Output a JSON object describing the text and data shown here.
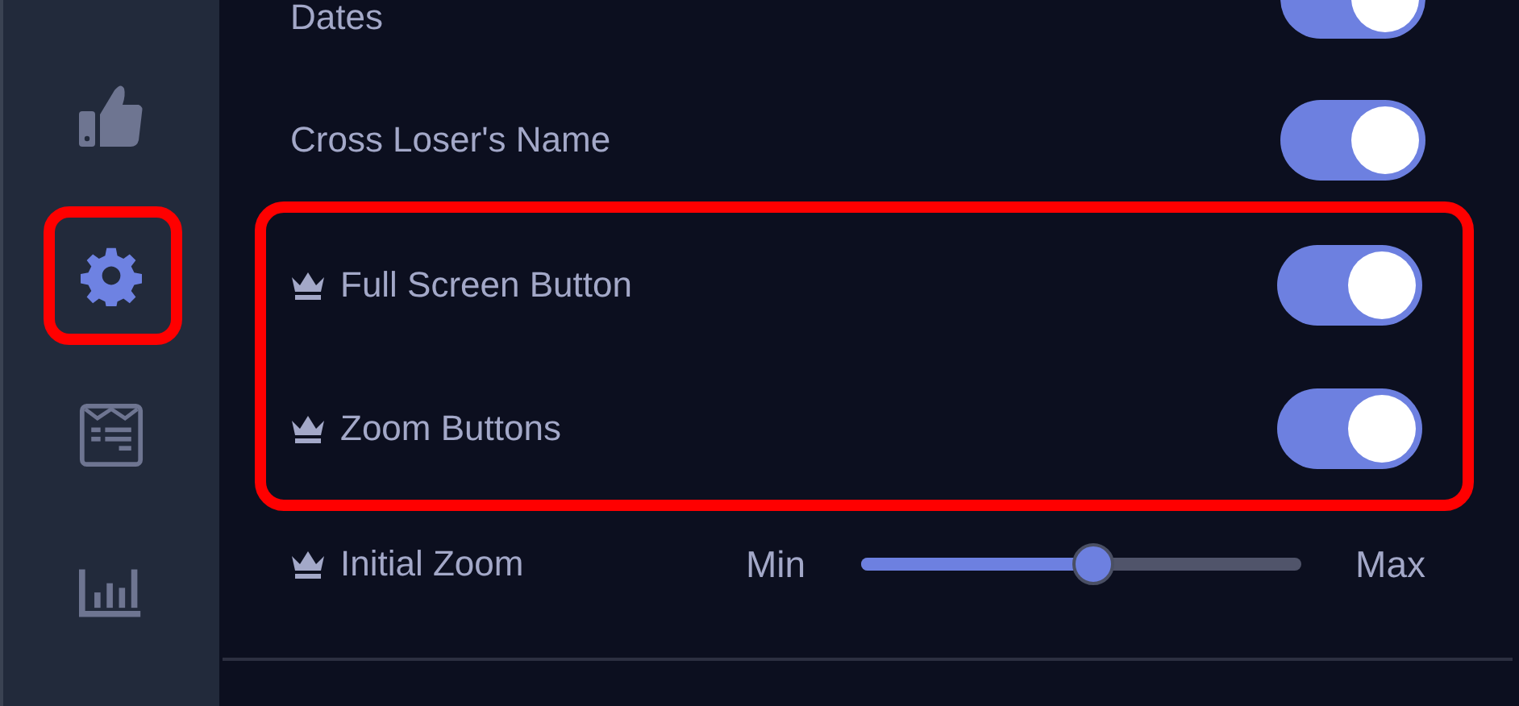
{
  "sidebar": {
    "items": [
      {
        "selected": false,
        "highlighted": false
      },
      {
        "selected": true,
        "highlighted": true
      },
      {
        "selected": false,
        "highlighted": false
      },
      {
        "selected": false,
        "highlighted": false
      }
    ]
  },
  "settings": [
    {
      "kind": "toggle",
      "label": "Dates",
      "premium": false,
      "on": true,
      "highlighted": false
    },
    {
      "kind": "toggle",
      "label": "Cross Loser's Name",
      "premium": false,
      "on": true,
      "highlighted": false
    },
    {
      "kind": "toggle",
      "label": "Full Screen Button",
      "premium": true,
      "on": true,
      "highlighted": true
    },
    {
      "kind": "toggle",
      "label": "Zoom Buttons",
      "premium": true,
      "on": true,
      "highlighted": true
    },
    {
      "kind": "slider",
      "label": "Initial Zoom",
      "premium": true,
      "min_label": "Min",
      "max_label": "Max",
      "level": 0.53,
      "highlighted": false
    }
  ]
}
